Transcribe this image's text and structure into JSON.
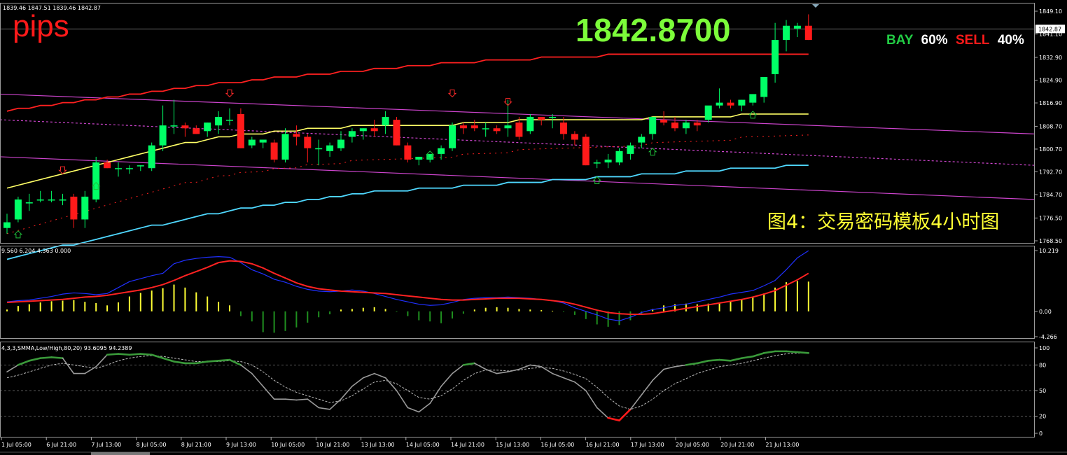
{
  "ohlc_readout": "1839.46 1847.51 1839.46 1842.87",
  "pips_label": "pips",
  "big_price": "1842.8700",
  "sentiment": {
    "buy_label": "BAY",
    "buy_pct": "60%",
    "sell_label": "SELL",
    "sell_pct": "40%"
  },
  "caption": "图4：交易密码模板4小时图",
  "macd_label": "9.560 6.204 4.363 0.000",
  "stoch_label": "4,3,3,SMMA,Low/High,80,20) 93.6095 94.2389",
  "colors": {
    "bull": "#00ff66",
    "bear": "#ff1a1a",
    "ma_yellow": "#ffff66",
    "band_red": "#ff2020",
    "cyan": "#4fd8ff",
    "magenta": "#cc44cc",
    "stoch_main": "#9a9a9a",
    "stoch_green": "#3a9a3a"
  },
  "chart_data": [
    {
      "type": "candlestick",
      "title": "",
      "price_axis": [
        "1849.10",
        "1841.10",
        "1832.90",
        "1824.90",
        "1816.90",
        "1808.70",
        "1800.70",
        "1792.70",
        "1784.70",
        "1776.50",
        "1768.50"
      ],
      "current_price_tag": "1842.87",
      "ylim": [
        1768.5,
        1849.1
      ],
      "candles": [
        [
          1773,
          1778,
          1771,
          1775
        ],
        [
          1776,
          1784,
          1775,
          1783
        ],
        [
          1782,
          1785,
          1779,
          1782
        ],
        [
          1783,
          1786,
          1782,
          1783
        ],
        [
          1783,
          1786,
          1782,
          1783
        ],
        [
          1783,
          1785,
          1781,
          1783
        ],
        [
          1784,
          1785,
          1773,
          1776
        ],
        [
          1776,
          1786,
          1773,
          1784
        ],
        [
          1783,
          1798,
          1782,
          1796
        ],
        [
          1796,
          1797,
          1794,
          1794
        ],
        [
          1794,
          1796,
          1791,
          1794
        ],
        [
          1794,
          1795,
          1792,
          1794
        ],
        [
          1795,
          1795,
          1793,
          1795
        ],
        [
          1794,
          1803,
          1793,
          1802
        ],
        [
          1802,
          1816,
          1800,
          1809
        ],
        [
          1809,
          1818,
          1806,
          1809
        ],
        [
          1809,
          1810,
          1805,
          1808
        ],
        [
          1808,
          1809,
          1806,
          1806
        ],
        [
          1807,
          1810,
          1805,
          1810
        ],
        [
          1809,
          1814,
          1806,
          1812
        ],
        [
          1811,
          1815,
          1809,
          1811
        ],
        [
          1813,
          1815,
          1801,
          1801
        ],
        [
          1802,
          1805,
          1801,
          1804
        ],
        [
          1803,
          1804,
          1801,
          1804
        ],
        [
          1803,
          1804,
          1796,
          1797
        ],
        [
          1797,
          1808,
          1796,
          1806
        ],
        [
          1806,
          1809,
          1802,
          1805
        ],
        [
          1805,
          1806,
          1796,
          1801
        ],
        [
          1801,
          1804,
          1795,
          1801
        ],
        [
          1800,
          1803,
          1798,
          1802
        ],
        [
          1801,
          1807,
          1800,
          1804
        ],
        [
          1805,
          1808,
          1803,
          1807
        ],
        [
          1807,
          1808,
          1804,
          1808
        ],
        [
          1808,
          1811,
          1805,
          1807
        ],
        [
          1809,
          1814,
          1806,
          1812
        ],
        [
          1811,
          1812,
          1802,
          1802
        ],
        [
          1802,
          1803,
          1796,
          1797
        ],
        [
          1797,
          1798,
          1795,
          1798
        ],
        [
          1797,
          1799,
          1796,
          1799
        ],
        [
          1799,
          1802,
          1797,
          1801
        ],
        [
          1801,
          1810,
          1800,
          1809
        ],
        [
          1809,
          1810,
          1806,
          1808
        ],
        [
          1809,
          1811,
          1807,
          1808
        ],
        [
          1808,
          1810,
          1805,
          1808
        ],
        [
          1808,
          1809,
          1806,
          1807
        ],
        [
          1808,
          1818,
          1805,
          1809
        ],
        [
          1810,
          1812,
          1804,
          1805
        ],
        [
          1807,
          1813,
          1806,
          1812
        ],
        [
          1812,
          1812,
          1809,
          1811
        ],
        [
          1812,
          1813,
          1808,
          1812
        ],
        [
          1810,
          1812,
          1804,
          1806
        ],
        [
          1806,
          1807,
          1802,
          1804
        ],
        [
          1805,
          1806,
          1795,
          1795
        ],
        [
          1796,
          1797,
          1794,
          1796
        ],
        [
          1796,
          1799,
          1794,
          1797
        ],
        [
          1796,
          1801,
          1795,
          1800
        ],
        [
          1799,
          1803,
          1797,
          1802
        ],
        [
          1803,
          1806,
          1801,
          1805
        ],
        [
          1806,
          1812,
          1804,
          1812
        ],
        [
          1811,
          1814,
          1809,
          1810
        ],
        [
          1810,
          1812,
          1807,
          1808
        ],
        [
          1808,
          1811,
          1806,
          1810
        ],
        [
          1810,
          1811,
          1807,
          1809
        ],
        [
          1811,
          1815,
          1810,
          1816
        ],
        [
          1816,
          1822,
          1815,
          1817
        ],
        [
          1817,
          1818,
          1815,
          1816
        ],
        [
          1816,
          1818,
          1814,
          1818
        ],
        [
          1817,
          1820,
          1816,
          1820
        ],
        [
          1819,
          1823,
          1817,
          1826
        ],
        [
          1827,
          1845,
          1824,
          1839
        ],
        [
          1839,
          1846,
          1835,
          1844
        ],
        [
          1843,
          1845,
          1840,
          1844
        ],
        [
          1844,
          1848,
          1839,
          1839
        ]
      ],
      "ma_yellow": [
        1787,
        1788,
        1789,
        1790,
        1791,
        1792,
        1793,
        1794,
        1795,
        1796,
        1797,
        1798,
        1799,
        1800,
        1801,
        1802,
        1803,
        1803,
        1804,
        1805,
        1805,
        1806,
        1806,
        1806,
        1807,
        1807,
        1807,
        1808,
        1808,
        1808,
        1808,
        1809,
        1809,
        1809,
        1809,
        1809,
        1809,
        1809,
        1809,
        1809,
        1809,
        1810,
        1810,
        1810,
        1810,
        1810,
        1811,
        1811,
        1811,
        1811,
        1811,
        1811,
        1811,
        1811,
        1811,
        1811,
        1811,
        1811,
        1812,
        1812,
        1812,
        1812,
        1812,
        1812,
        1812,
        1812,
        1813,
        1813,
        1813,
        1813,
        1813,
        1813,
        1813
      ],
      "band_upper_red": [
        1814,
        1815,
        1815,
        1816,
        1816,
        1817,
        1817,
        1818,
        1818,
        1819,
        1819,
        1820,
        1820,
        1821,
        1821,
        1822,
        1822,
        1823,
        1823,
        1824,
        1824,
        1824,
        1825,
        1825,
        1826,
        1826,
        1826,
        1827,
        1827,
        1827,
        1828,
        1828,
        1828,
        1829,
        1829,
        1829,
        1830,
        1830,
        1830,
        1831,
        1831,
        1831,
        1831,
        1832,
        1832,
        1832,
        1832,
        1832,
        1833,
        1833,
        1833,
        1833,
        1833,
        1833,
        1834,
        1834,
        1834,
        1834,
        1834,
        1834,
        1834,
        1834,
        1834,
        1834,
        1834,
        1834,
        1834,
        1834,
        1834,
        1834,
        1834,
        1834,
        1834
      ],
      "lower_cyan": [
        1762,
        1763,
        1764,
        1765,
        1766,
        1767,
        1767,
        1768,
        1769,
        1770,
        1771,
        1772,
        1773,
        1774,
        1774,
        1775,
        1776,
        1777,
        1778,
        1778,
        1779,
        1780,
        1780,
        1781,
        1781,
        1782,
        1782,
        1783,
        1783,
        1784,
        1784,
        1785,
        1785,
        1786,
        1786,
        1786,
        1786,
        1787,
        1787,
        1787,
        1787,
        1788,
        1788,
        1788,
        1788,
        1789,
        1789,
        1789,
        1789,
        1790,
        1790,
        1790,
        1790,
        1791,
        1791,
        1791,
        1791,
        1792,
        1792,
        1792,
        1792,
        1793,
        1793,
        1793,
        1793,
        1794,
        1794,
        1794,
        1794,
        1794,
        1795,
        1795,
        1795
      ],
      "markers_down": [
        [
          5,
          1793
        ],
        [
          20,
          1820
        ],
        [
          40,
          1820
        ],
        [
          45,
          1817
        ]
      ],
      "markers_up": [
        [
          1,
          1771
        ],
        [
          8,
          1788
        ],
        [
          38,
          1799
        ],
        [
          53,
          1790
        ],
        [
          58,
          1800
        ],
        [
          67,
          1813
        ]
      ]
    },
    {
      "type": "histogram",
      "title": "",
      "price_axis": [
        "10.219",
        "0.00",
        "-4.266"
      ],
      "ylim": [
        -4.266,
        10.219
      ],
      "hist": [
        0.3,
        0.9,
        1.2,
        1.5,
        1.7,
        1.8,
        1.9,
        1.6,
        1.4,
        1.0,
        1.5,
        2.5,
        3.1,
        3.5,
        3.9,
        4.5,
        4.0,
        3.2,
        2.5,
        1.6,
        1.0,
        -0.8,
        -1.7,
        -3.5,
        -3.6,
        -3.3,
        -2.7,
        -1.9,
        -1.0,
        -0.5,
        0.3,
        0.4,
        0.6,
        0.7,
        0.4,
        -0.1,
        -0.8,
        -1.5,
        -1.7,
        -2.0,
        -1.2,
        -0.4,
        0.3,
        0.6,
        0.7,
        0.6,
        0.4,
        0.3,
        0.2,
        0.1,
        -0.1,
        -0.6,
        -1.3,
        -2.2,
        -2.6,
        -2.3,
        -1.5,
        -0.5,
        0.4,
        1.0,
        1.2,
        1.3,
        1.2,
        1.3,
        1.5,
        1.8,
        2.0,
        2.4,
        3.0,
        4.0,
        4.9,
        5.1,
        5.0
      ],
      "macd_blue": [
        1.6,
        1.8,
        1.9,
        2.2,
        2.5,
        2.9,
        3.1,
        3.0,
        2.8,
        3.0,
        4.0,
        5.0,
        5.5,
        6.0,
        6.4,
        8.0,
        8.6,
        8.9,
        9.1,
        9.2,
        9.1,
        8.2,
        7.0,
        6.3,
        5.4,
        4.9,
        4.2,
        3.7,
        3.4,
        3.3,
        3.4,
        3.6,
        3.4,
        3.0,
        2.5,
        2.0,
        1.6,
        1.2,
        1.0,
        1.1,
        1.5,
        2.0,
        2.2,
        2.3,
        2.3,
        2.4,
        2.3,
        2.2,
        2.0,
        1.8,
        1.4,
        0.6,
        0.0,
        -0.6,
        -1.3,
        -1.6,
        -1.0,
        -0.2,
        0.3,
        0.6,
        1.0,
        1.2,
        1.6,
        2.0,
        2.4,
        2.9,
        3.2,
        3.5,
        4.3,
        5.2,
        7.0,
        9.0,
        10.2
      ],
      "signal_red": [
        1.5,
        1.6,
        1.7,
        1.8,
        1.9,
        2.0,
        2.2,
        2.4,
        2.5,
        2.7,
        3.0,
        3.3,
        3.6,
        4.0,
        4.5,
        5.2,
        6.0,
        6.7,
        7.4,
        8.2,
        8.5,
        8.4,
        8.0,
        7.3,
        6.4,
        5.6,
        4.8,
        4.2,
        3.8,
        3.6,
        3.4,
        3.3,
        3.2,
        3.1,
        3.0,
        2.8,
        2.6,
        2.4,
        2.2,
        2.0,
        1.9,
        1.9,
        2.0,
        2.1,
        2.2,
        2.2,
        2.2,
        2.1,
        2.0,
        1.8,
        1.6,
        1.2,
        0.7,
        0.2,
        -0.2,
        -0.4,
        -0.5,
        -0.5,
        -0.4,
        -0.1,
        0.2,
        0.5,
        0.8,
        1.1,
        1.4,
        1.7,
        2.0,
        2.4,
        2.9,
        3.5,
        4.4,
        5.3,
        6.4
      ]
    },
    {
      "type": "line",
      "title": "",
      "price_axis": [
        "100",
        "80",
        "50",
        "20",
        "0"
      ],
      "ylim": [
        0,
        100
      ],
      "stoch_main": [
        72,
        80,
        85,
        88,
        89,
        88,
        70,
        70,
        78,
        92,
        93,
        92,
        93,
        92,
        88,
        84,
        82,
        82,
        84,
        85,
        86,
        80,
        70,
        55,
        40,
        40,
        39,
        40,
        30,
        28,
        40,
        55,
        65,
        70,
        65,
        50,
        30,
        25,
        35,
        55,
        70,
        80,
        82,
        75,
        70,
        72,
        75,
        80,
        78,
        70,
        65,
        60,
        50,
        30,
        18,
        15,
        28,
        45,
        62,
        75,
        78,
        80,
        82,
        85,
        86,
        85,
        88,
        90,
        94,
        96,
        96,
        95,
        94
      ],
      "stoch_signal": [
        65,
        68,
        72,
        76,
        80,
        82,
        80,
        78,
        76,
        80,
        85,
        88,
        90,
        91,
        90,
        88,
        86,
        84,
        84,
        84,
        85,
        84,
        80,
        72,
        62,
        54,
        48,
        44,
        40,
        36,
        38,
        44,
        52,
        60,
        62,
        58,
        50,
        42,
        40,
        44,
        52,
        62,
        70,
        74,
        74,
        73,
        74,
        76,
        77,
        76,
        73,
        69,
        64,
        54,
        42,
        32,
        28,
        32,
        40,
        50,
        58,
        64,
        70,
        74,
        78,
        80,
        82,
        85,
        88,
        91,
        93,
        94,
        94
      ],
      "levels": [
        80,
        50,
        20
      ]
    }
  ],
  "time_axis": [
    "1 Jul 05:00",
    "6 Jul 21:00",
    "7 Jul 13:00",
    "8 Jul 05:00",
    "8 Jul 21:00",
    "9 Jul 13:00",
    "10 Jul 05:00",
    "10 Jul 21:00",
    "13 Jul 13:00",
    "14 Jul 05:00",
    "14 Jul 21:00",
    "15 Jul 13:00",
    "16 Jul 05:00",
    "16 Jul 21:00",
    "17 Jul 13:00",
    "20 Jul 05:00",
    "20 Jul 21:00",
    "21 Jul 13:00"
  ]
}
